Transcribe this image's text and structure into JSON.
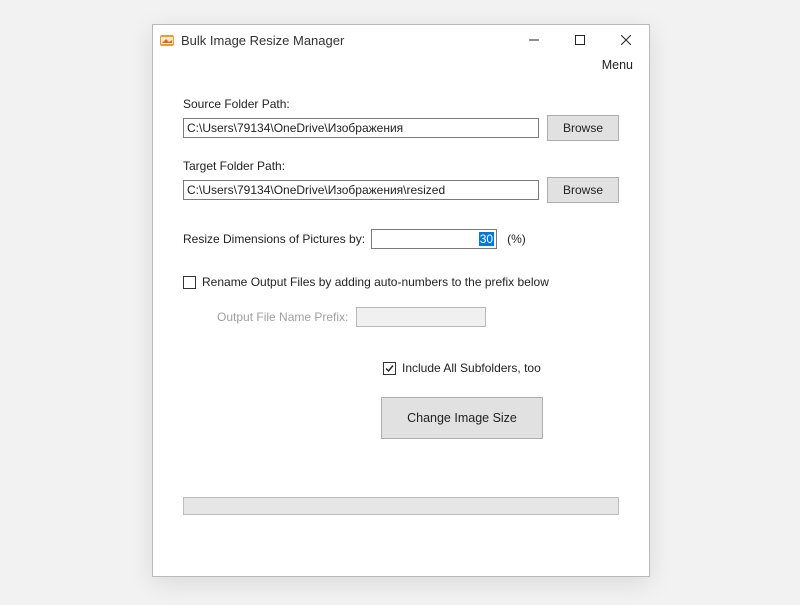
{
  "window": {
    "title": "Bulk Image Resize Manager",
    "menu_label": "Menu"
  },
  "fields": {
    "source_label": "Source Folder Path:",
    "source_value": "C:\\Users\\79134\\OneDrive\\Изображения",
    "target_label": "Target Folder Path:",
    "target_value": "C:\\Users\\79134\\OneDrive\\Изображения\\resized",
    "browse_label": "Browse",
    "resize_label": "Resize Dimensions of Pictures by:",
    "resize_value": "30",
    "resize_suffix": "(%)",
    "rename_label": "Rename Output Files by adding auto-numbers to the prefix below",
    "rename_checked": false,
    "prefix_label": "Output File Name Prefix:",
    "prefix_value": "",
    "subfolders_label": "Include All Subfolders, too",
    "subfolders_checked": true,
    "action_label": "Change Image Size"
  }
}
